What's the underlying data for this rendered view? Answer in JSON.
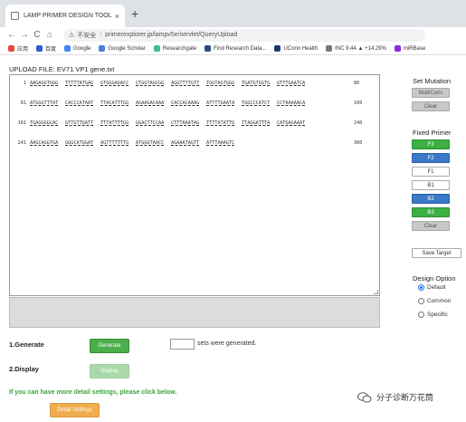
{
  "browser": {
    "tab_title": "LAMP PRIMER DESIGN TOOL",
    "tab_close": "×",
    "new_tab": "+",
    "nav_back": "←",
    "nav_forward": "→",
    "nav_reload": "C",
    "nav_home": "⌂",
    "insecure_label": "不安全",
    "url": "primerexplorer.jp/lampv5e/servlet/QueryUpload",
    "bookmarks": [
      {
        "label": "应用",
        "color": "#e8453c"
      },
      {
        "label": "百度",
        "color": "#2f5dd1"
      },
      {
        "label": "Google",
        "color": "#4285f4"
      },
      {
        "label": "Google Scholar",
        "color": "#4a7fd6"
      },
      {
        "label": "Researchgate",
        "color": "#40ba9b"
      },
      {
        "label": "Find Research Data...",
        "color": "#2c4a80"
      },
      {
        "label": "UConn Health",
        "color": "#1b3a6b"
      },
      {
        "label": "INC 9.44 ▲ +14.29%",
        "color": "#777777"
      },
      {
        "label": "miRBase",
        "color": "#8a2be2"
      }
    ]
  },
  "page": {
    "upload_title": "UPLOAD FILE: EV71 VP1 gene.txt",
    "sequence_lines": [
      {
        "start": "1",
        "blocks": [
          "AAGAGGTGGG",
          "TTTTTATGAG",
          "GTGGGAGACC",
          "CTGGTAGCGG",
          "AGGTTTTGTT",
          "TGGTAGTGGG",
          "TGATGTGGTG",
          "GTTTGAATCA"
        ],
        "end": "80"
      },
      {
        "start": "81",
        "blocks": [
          "ATGGGTTTAT",
          "CACCCATAAT",
          "TTACATTTGG",
          "AGAAGACAAA",
          "CACCACAAAG",
          "ATTTTGAATA",
          "TGGCCCATCT",
          "CCTAAAAACA"
        ],
        "end": "160"
      },
      {
        "start": "161",
        "blocks": [
          "TGAGGGGCAC",
          "GTTGTTGATT",
          "TTTATTTTGG",
          "GGACTTCCAA",
          "CTTTAAATAG",
          "TTTTATATTG",
          "TTAGGATTTA",
          "CATGAGAAAT"
        ],
        "end": "240"
      },
      {
        "start": "241",
        "blocks": [
          "AAGCAGGTGA",
          "GGGCATGGAT",
          "AGTTTTTTTG",
          "ATGGGTAACC",
          "AGAAATAGTT",
          "ATTTAAAGTC"
        ],
        "end": "300"
      }
    ],
    "generate_label": "1.Generate",
    "generate_button": "Generate",
    "sets_text": "sets were generated.",
    "sets_value": "",
    "display_label": "2.Display",
    "display_button": "Display",
    "detail_note": "If you can have more detail settings, please click below.",
    "detail_button": "Detail Settings"
  },
  "side": {
    "set_mutation_title": "Set Mutation",
    "mutation_buttons": [
      "MultiCons",
      "Clear"
    ],
    "fixed_primer_title": "Fixed Primer",
    "fixed_primer_buttons": [
      {
        "label": "F3",
        "style": "green"
      },
      {
        "label": "F2",
        "style": "blue"
      },
      {
        "label": "F1",
        "style": "white"
      },
      {
        "label": "B1",
        "style": "white"
      },
      {
        "label": "B2",
        "style": "blue"
      },
      {
        "label": "B3",
        "style": "green"
      },
      {
        "label": "Clear",
        "style": "gray"
      }
    ],
    "save_target": "Save Target",
    "design_option_title": "Design Option",
    "design_options": [
      {
        "label": "Default",
        "selected": true
      },
      {
        "label": "Common",
        "selected": false
      },
      {
        "label": "Specific",
        "selected": false
      }
    ]
  },
  "watermark": {
    "text": "分子诊断万花筒"
  },
  "colors": {
    "green": "#4cae4c",
    "blue": "#3a78c9",
    "orange": "#f0ad4e",
    "note_green": "#3aa53a"
  }
}
